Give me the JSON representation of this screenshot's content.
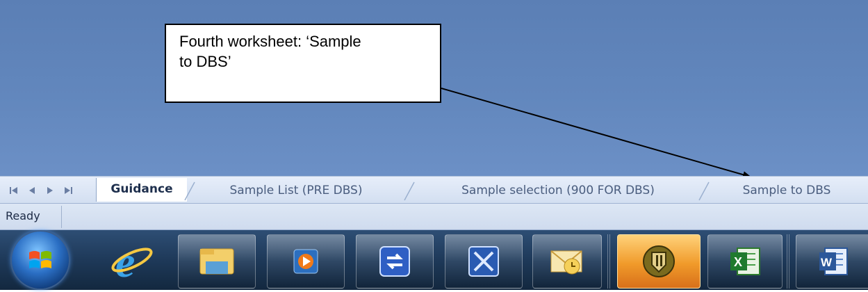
{
  "callout": {
    "line1": "Fourth worksheet: ‘Sample",
    "line2": "to DBS’"
  },
  "sheet_nav": {
    "buttons": [
      "first-sheet",
      "previous-sheet",
      "next-sheet",
      "last-sheet"
    ]
  },
  "sheet_tabs": [
    {
      "label": "Guidance",
      "active": true
    },
    {
      "label": "Sample List (PRE DBS)",
      "active": false
    },
    {
      "label": "Sample selection (900 FOR DBS)",
      "active": false
    },
    {
      "label": "Sample to DBS",
      "active": false
    }
  ],
  "status_bar": {
    "text": "Ready"
  },
  "taskbar": {
    "items": [
      {
        "name": "start-orb-icon"
      },
      {
        "name": "internet-explorer-icon"
      },
      {
        "name": "windows-explorer-icon"
      },
      {
        "name": "media-player-icon"
      },
      {
        "name": "sync-app-icon"
      },
      {
        "name": "remote-app-icon"
      },
      {
        "name": "outlook-icon"
      },
      {
        "name": "security-shield-icon"
      },
      {
        "name": "excel-icon"
      },
      {
        "name": "word-icon"
      }
    ]
  },
  "colors": {
    "workspace_blue": "#6287bd",
    "taskbar_dark": "#1e3959",
    "active_taskbar_orange": "#f09a2a",
    "tab_text": "#4a5d7e"
  }
}
